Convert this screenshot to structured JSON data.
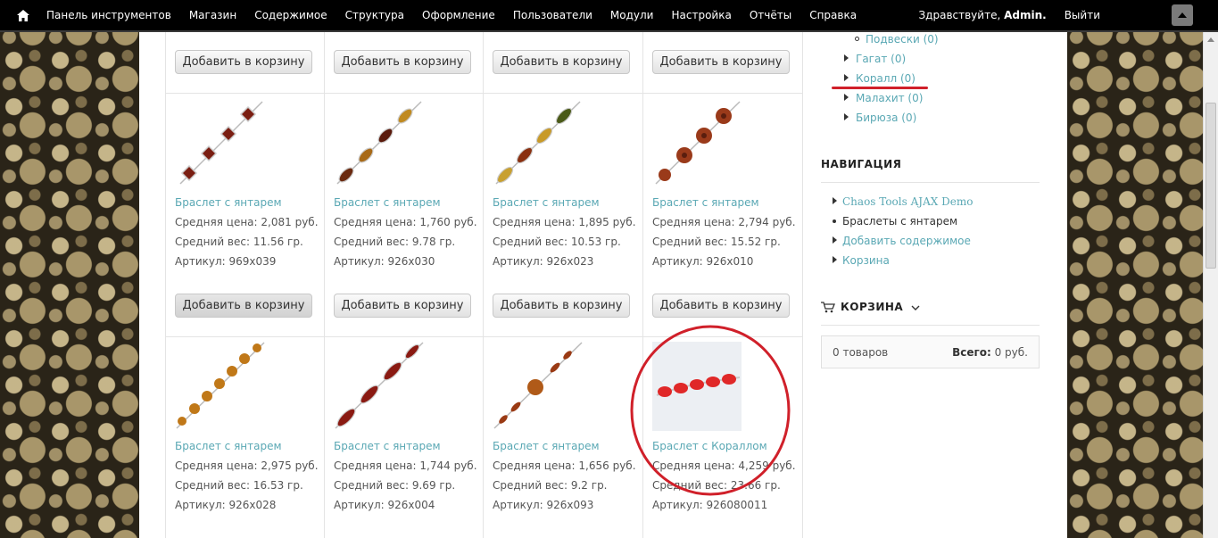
{
  "toolbar": {
    "menu": [
      "Панель инструментов",
      "Магазин",
      "Содержимое",
      "Структура",
      "Оформление",
      "Пользователи",
      "Модули",
      "Настройка",
      "Отчёты",
      "Справка"
    ],
    "greeting": "Здравствуйте,",
    "user": "Admin.",
    "logout": "Выйти"
  },
  "products": {
    "add_to_cart": "Добавить в корзину",
    "price_label": "Средняя цена:",
    "weight_label": "Средний вес:",
    "article_label": "Артикул:",
    "row1": [
      {
        "name": "Браслет с янтарем",
        "price": "2,081 руб.",
        "weight": "11.56 гр.",
        "article": "969x039"
      },
      {
        "name": "Браслет с янтарем",
        "price": "1,760 руб.",
        "weight": "9.78 гр.",
        "article": "926x030"
      },
      {
        "name": "Браслет с янтарем",
        "price": "1,895 руб.",
        "weight": "10.53 гр.",
        "article": "926x023"
      },
      {
        "name": "Браслет с янтарем",
        "price": "2,794 руб.",
        "weight": "15.52 гр.",
        "article": "926x010"
      }
    ],
    "row2": [
      {
        "name": "Браслет с янтарем",
        "price": "2,975 руб.",
        "weight": "16.53 гр.",
        "article": "926x028"
      },
      {
        "name": "Браслет с янтарем",
        "price": "1,744 руб.",
        "weight": "9.69 гр.",
        "article": "926x004"
      },
      {
        "name": "Браслет с янтарем",
        "price": "1,656 руб.",
        "weight": "9.2 гр.",
        "article": "926x093"
      },
      {
        "name": "Браслет с Кораллом",
        "price": "4,259 руб.",
        "weight": "23.66 гр.",
        "article": "926080011"
      }
    ]
  },
  "sidebar": {
    "categories": [
      {
        "label": "Подвески (0)"
      },
      {
        "label": "Гагат (0)"
      },
      {
        "label": "Коралл (0)"
      },
      {
        "label": "Малахит (0)"
      },
      {
        "label": "Бирюза (0)"
      }
    ],
    "nav_title": "НАВИГАЦИЯ",
    "nav_items": [
      {
        "label": "Chaos Tools AJAX Demo"
      },
      {
        "label": "Браслеты с янтарем"
      },
      {
        "label": "Добавить содержимое"
      },
      {
        "label": "Корзина"
      }
    ],
    "cart_title": "КОРЗИНА",
    "cart_items": "0 товаров",
    "cart_total_label": "Всего:",
    "cart_total_value": "0 руб."
  },
  "colors": {
    "link": "#5aa8b4",
    "annotation": "#d0202a",
    "toolbar_bg": "#000000"
  }
}
